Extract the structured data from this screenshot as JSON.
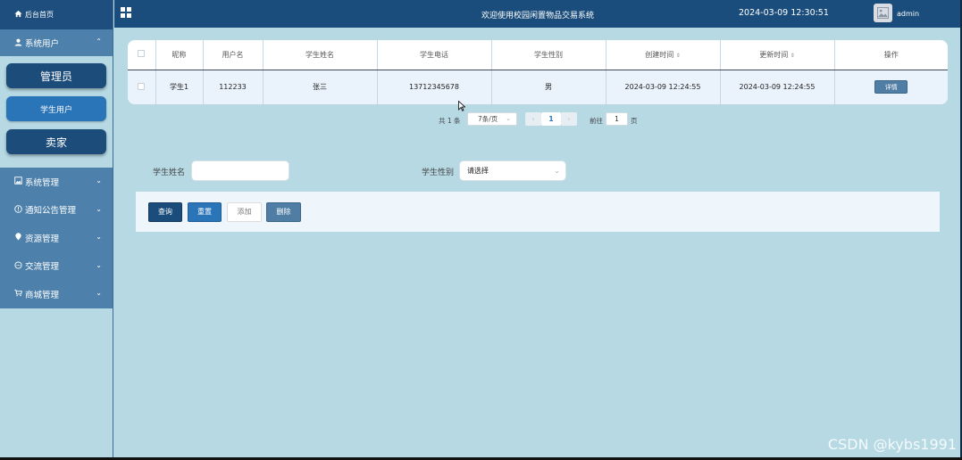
{
  "sidebar": {
    "home": "后台首页",
    "system_users": "系统用户",
    "sub_items": [
      "管理员",
      "学生用户",
      "卖家"
    ],
    "menu": [
      {
        "label": "系统管理",
        "icon": "image-icon"
      },
      {
        "label": "通知公告管理",
        "icon": "info-icon"
      },
      {
        "label": "资源管理",
        "icon": "location-icon"
      },
      {
        "label": "交流管理",
        "icon": "chat-icon"
      },
      {
        "label": "商城管理",
        "icon": "cart-icon"
      }
    ]
  },
  "header": {
    "title": "欢迎使用校园闲置物品交易系统",
    "datetime": "2024-03-09 12:30:51",
    "username": "admin"
  },
  "table": {
    "columns": [
      "昵称",
      "用户名",
      "学生姓名",
      "学生电话",
      "学生性别",
      "创建时间",
      "更新时间",
      "操作"
    ],
    "rows": [
      {
        "nickname": "学生1",
        "username": "112233",
        "name": "张三",
        "phone": "13712345678",
        "gender": "男",
        "created": "2024-03-09 12:24:55",
        "updated": "2024-03-09 12:24:55",
        "action": "详情"
      }
    ]
  },
  "pagination": {
    "total": "共 1 条",
    "page_size": "7条/页",
    "current": "1",
    "goto": "前往",
    "goto_value": "1",
    "page_unit": "页"
  },
  "search": {
    "name_label": "学生姓名",
    "name_value": "",
    "gender_label": "学生性别",
    "gender_placeholder": "请选择"
  },
  "buttons": {
    "query": "查询",
    "reset": "重置",
    "add": "添加",
    "delete": "删除"
  },
  "watermark": "CSDN @kybs1991"
}
